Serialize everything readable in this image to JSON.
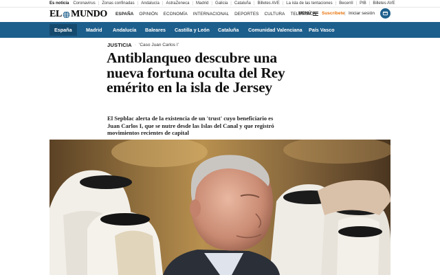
{
  "trending": {
    "lead": "Es noticia",
    "items": [
      "Coronavirus",
      "Zonas confinadas",
      "Andalucía",
      "AstraZeneca",
      "Madrid",
      "Galicia",
      "Cataluña",
      "Billetes AVE",
      "La isla de las tentaciones",
      "Becerril",
      "PIB",
      "Billetes AVE"
    ]
  },
  "header": {
    "logo_left": "EL",
    "logo_right": "MUNDO",
    "nav": [
      "ESPAÑA",
      "OPINIÓN",
      "ECONOMÍA",
      "INTERNACIONAL",
      "DEPORTES",
      "CULTURA",
      "TELEVISIÓN"
    ],
    "menu_label": "MENÚ",
    "subscribe": "Suscríbete",
    "separator": "|",
    "login": "Iniciar sesión"
  },
  "regions": {
    "items": [
      "España",
      "Madrid",
      "Andalucía",
      "Baleares",
      "Castilla y León",
      "Cataluña",
      "Comunidad Valenciana",
      "País Vasco"
    ],
    "active_index": 0
  },
  "article": {
    "section": "JUSTICIA",
    "tag": "'Caso Juan Carlos I'",
    "headline": "Antiblanqueo descubre una nueva fortuna oculta del Rey emérito en la isla de Jersey",
    "lede": "El Sepblac alerta de la existencia de un 'trust' cuyo beneficiario es Juan Carlos I, que se nutre desde las Islas del Canal y que registró movimientos recientes de capital"
  },
  "colors": {
    "brand_blue": "#1d5f8c",
    "nav_active": "#154a6f",
    "subscribe_orange": "#e8720a"
  },
  "icons": {
    "menu": "hamburger-icon",
    "user": "user-icon",
    "logo_globe": "globe-icon"
  }
}
